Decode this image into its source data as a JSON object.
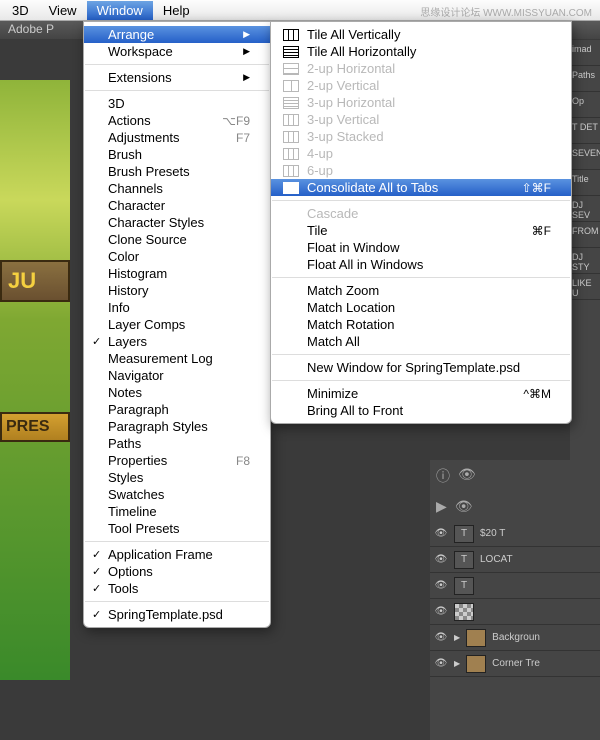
{
  "watermark": "思缘设计论坛 WWW.MISSYUAN.COM",
  "menubar": {
    "items": [
      "3D",
      "View",
      "Window",
      "Help"
    ],
    "active_index": 2
  },
  "appbar": {
    "title": "Adobe P"
  },
  "canvas": {
    "sign1": "JU",
    "sign2": "PRES"
  },
  "window_menu": {
    "groups": [
      [
        {
          "label": "Arrange",
          "arrow": true,
          "hl": true
        },
        {
          "label": "Workspace",
          "arrow": true
        }
      ],
      [
        {
          "label": "Extensions",
          "arrow": true
        }
      ],
      [
        {
          "label": "3D"
        },
        {
          "label": "Actions",
          "shortcut": "⌥F9"
        },
        {
          "label": "Adjustments",
          "shortcut": "F7"
        },
        {
          "label": "Brush"
        },
        {
          "label": "Brush Presets"
        },
        {
          "label": "Channels"
        },
        {
          "label": "Character"
        },
        {
          "label": "Character Styles"
        },
        {
          "label": "Clone Source"
        },
        {
          "label": "Color"
        },
        {
          "label": "Histogram"
        },
        {
          "label": "History"
        },
        {
          "label": "Info"
        },
        {
          "label": "Layer Comps"
        },
        {
          "label": "Layers",
          "check": true
        },
        {
          "label": "Measurement Log"
        },
        {
          "label": "Navigator"
        },
        {
          "label": "Notes"
        },
        {
          "label": "Paragraph"
        },
        {
          "label": "Paragraph Styles"
        },
        {
          "label": "Paths"
        },
        {
          "label": "Properties",
          "shortcut": "F8"
        },
        {
          "label": "Styles"
        },
        {
          "label": "Swatches"
        },
        {
          "label": "Timeline"
        },
        {
          "label": "Tool Presets"
        }
      ],
      [
        {
          "label": "Application Frame",
          "check": true
        },
        {
          "label": "Options",
          "check": true
        },
        {
          "label": "Tools",
          "check": true
        }
      ],
      [
        {
          "label": "SpringTemplate.psd",
          "check": true
        }
      ]
    ]
  },
  "arrange_menu": {
    "groups": [
      [
        {
          "label": "Tile All Vertically",
          "ico": "v3"
        },
        {
          "label": "Tile All Horizontally",
          "ico": "h3"
        },
        {
          "label": "2-up Horizontal",
          "ico": "h2",
          "dis": true
        },
        {
          "label": "2-up Vertical",
          "ico": "v2",
          "dis": true
        },
        {
          "label": "3-up Horizontal",
          "ico": "h3",
          "dis": true
        },
        {
          "label": "3-up Vertical",
          "ico": "v3",
          "dis": true
        },
        {
          "label": "3-up Stacked",
          "ico": "v3",
          "dis": true
        },
        {
          "label": "4-up",
          "ico": "v3",
          "dis": true
        },
        {
          "label": "6-up",
          "ico": "v3",
          "dis": true
        },
        {
          "label": "Consolidate All to Tabs",
          "ico": "solid",
          "hl": true,
          "shortcut": "⇧⌘F"
        }
      ],
      [
        {
          "label": "Cascade",
          "dis": true
        },
        {
          "label": "Tile",
          "shortcut": "⌘F"
        },
        {
          "label": "Float in Window"
        },
        {
          "label": "Float All in Windows"
        }
      ],
      [
        {
          "label": "Match Zoom"
        },
        {
          "label": "Match Location"
        },
        {
          "label": "Match Rotation"
        },
        {
          "label": "Match All"
        }
      ],
      [
        {
          "label": "New Window for SpringTemplate.psd"
        }
      ],
      [
        {
          "label": "Minimize",
          "shortcut": "^⌘M"
        },
        {
          "label": "Bring All to Front"
        }
      ]
    ]
  },
  "right_stubs": [
    "imad",
    "Paths",
    "Op",
    "T DET",
    "SEVEN",
    "Title",
    "DJ SEV",
    "FROM",
    "DJ STY",
    "LIKE U"
  ],
  "layers": [
    {
      "type": "T",
      "name": "$20 T"
    },
    {
      "type": "T",
      "name": "LOCAT"
    },
    {
      "type": "T",
      "name": ""
    },
    {
      "type": "checker",
      "name": ""
    },
    {
      "type": "folder",
      "name": "Backgroun"
    },
    {
      "type": "folder",
      "name": "Corner Tre"
    }
  ]
}
